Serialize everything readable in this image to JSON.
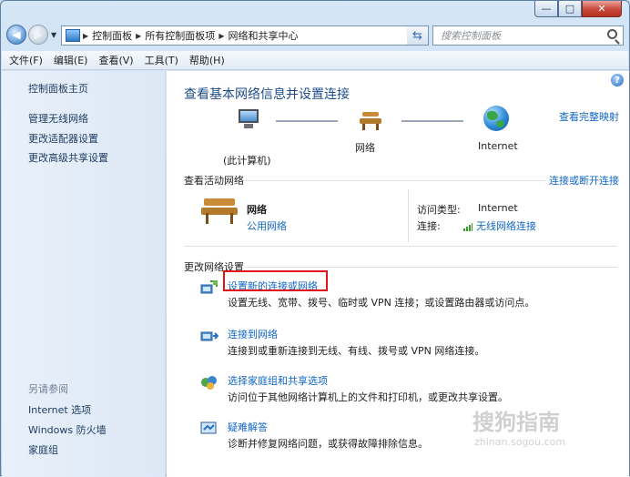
{
  "window": {
    "caption_buttons": {
      "minimize": "—",
      "maximize": "□",
      "close": "✕"
    }
  },
  "nav": {
    "back_icon": "back-arrow-icon",
    "forward_icon": "forward-arrow-icon",
    "breadcrumb": [
      "控制面板",
      "所有控制面板项",
      "网络和共享中心"
    ],
    "search_placeholder": "搜索控制面板"
  },
  "menu": [
    "文件(F)",
    "编辑(E)",
    "查看(V)",
    "工具(T)",
    "帮助(H)"
  ],
  "sidebar": {
    "home": "控制面板主页",
    "links": [
      "管理无线网络",
      "更改适配器设置",
      "更改高级共享设置"
    ],
    "see_also_title": "另请参阅",
    "see_also": [
      "Internet 选项",
      "Windows 防火墙",
      "家庭组"
    ]
  },
  "main": {
    "title": "查看基本网络信息并设置连接",
    "full_map_link": "查看完整映射",
    "map": {
      "computer_label": "(此计算机)",
      "network_label": "网络",
      "internet_label": "Internet"
    },
    "active_networks": {
      "heading": "查看活动网络",
      "connect_link": "连接或断开连接",
      "network_name": "网络",
      "network_type": "公用网络",
      "access_type_label": "访问类型:",
      "access_type_value": "Internet",
      "connection_label": "连接:",
      "connection_value": "无线网络连接"
    },
    "change_settings": {
      "heading": "更改网络设置",
      "tasks": [
        {
          "link": "设置新的连接或网络",
          "desc": "设置无线、宽带、拨号、临时或 VPN 连接；或设置路由器或访问点。"
        },
        {
          "link": "连接到网络",
          "desc": "连接到或重新连接到无线、有线、拨号或 VPN 网络连接。"
        },
        {
          "link": "选择家庭组和共享选项",
          "desc": "访问位于其他网络计算机上的文件和打印机，或更改共享设置。"
        },
        {
          "link": "疑难解答",
          "desc": "诊断并修复网络问题，或获得故障排除信息。"
        }
      ]
    }
  },
  "watermark": {
    "text": "搜狗指南",
    "url": "zhinan.sogou.com"
  }
}
